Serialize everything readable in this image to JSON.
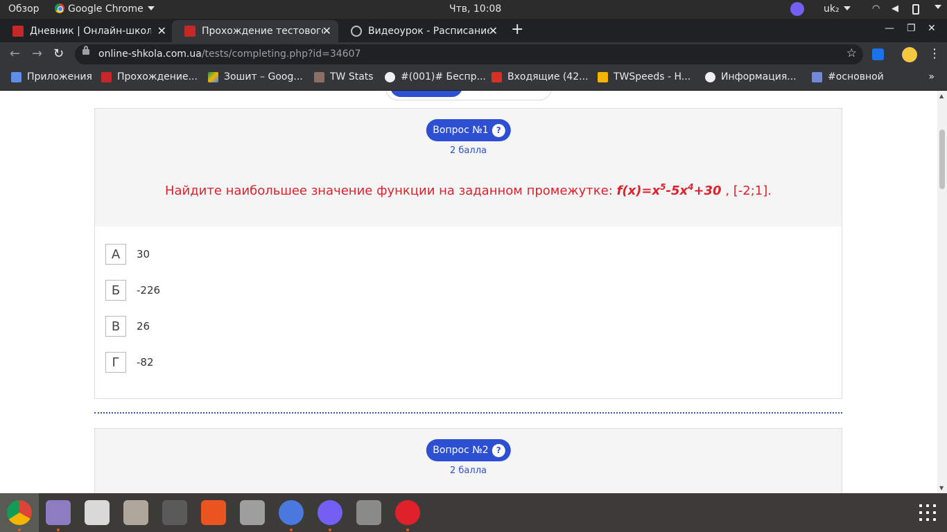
{
  "system_bar": {
    "activities": "Обзор",
    "app_name": "Google Chrome",
    "clock": "Чтв, 10:08",
    "keyboard_layout": "uk₂"
  },
  "browser": {
    "tabs": [
      {
        "title": "Дневник | Онлайн-школа",
        "active": false
      },
      {
        "title": "Прохождение тестового",
        "active": true
      },
      {
        "title": "Видеоурок - Расписание",
        "active": false
      }
    ],
    "url": {
      "host": "online-shkola.com.ua",
      "path": "/tests/completing.php?id=34607"
    },
    "bookmarks": [
      "Приложения",
      "Прохождение...",
      "Зошит – Goog...",
      "TW Stats",
      "#(001)# Беспр...",
      "Входящие (42...",
      "TWSpeeds - H...",
      "Информация...",
      "#основной"
    ],
    "bookmarks_more": "»"
  },
  "question1": {
    "badge": "Вопрос №1",
    "help": "?",
    "points": "2 балла",
    "prompt": "Найдите наибольшее значение функции на заданном промежутке:",
    "formula": {
      "part1": "f(x)=x",
      "exp1": "5",
      "part2": "-5x",
      "exp2": "4",
      "part3": "+30"
    },
    "interval": ", [-2;1]."
  },
  "answers": [
    {
      "letter": "А",
      "value": "30"
    },
    {
      "letter": "Б",
      "value": "-226"
    },
    {
      "letter": "В",
      "value": "26"
    },
    {
      "letter": "Г",
      "value": "-82"
    }
  ],
  "question2": {
    "badge": "Вопрос №2",
    "help": "?",
    "points": "2 балла"
  },
  "colors": {
    "accent": "#2d4fd2",
    "question_text": "#e0202b"
  }
}
